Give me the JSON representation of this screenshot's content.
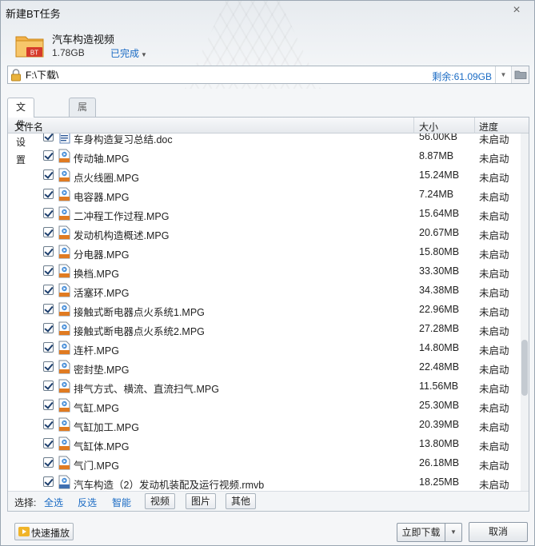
{
  "window": {
    "title": "新建BT任务",
    "close_icon": "×"
  },
  "task": {
    "name": "汽车构造视频",
    "size": "1.78GB",
    "status": "已完成",
    "badge": "BT",
    "accent": "#f0a436"
  },
  "path": {
    "value": "F:\\下载\\",
    "free_space": "剩余:61.09GB"
  },
  "tabs": [
    {
      "label": "文件设置",
      "active": true
    },
    {
      "label": "属性设置",
      "active": false
    }
  ],
  "columns": {
    "name": "文件名",
    "size": "大小",
    "progress": "进度"
  },
  "files": [
    {
      "name": "车身构造复习总结.doc",
      "size": "56.00KB",
      "progress": "未启动",
      "type": "doc"
    },
    {
      "name": "传动轴.MPG",
      "size": "8.87MB",
      "progress": "未启动",
      "type": "mpg"
    },
    {
      "name": "点火线圈.MPG",
      "size": "15.24MB",
      "progress": "未启动",
      "type": "mpg"
    },
    {
      "name": "电容器.MPG",
      "size": "7.24MB",
      "progress": "未启动",
      "type": "mpg"
    },
    {
      "name": "二冲程工作过程.MPG",
      "size": "15.64MB",
      "progress": "未启动",
      "type": "mpg"
    },
    {
      "name": "发动机构造概述.MPG",
      "size": "20.67MB",
      "progress": "未启动",
      "type": "mpg"
    },
    {
      "name": "分电器.MPG",
      "size": "15.80MB",
      "progress": "未启动",
      "type": "mpg"
    },
    {
      "name": "换档.MPG",
      "size": "33.30MB",
      "progress": "未启动",
      "type": "mpg"
    },
    {
      "name": "活塞环.MPG",
      "size": "34.38MB",
      "progress": "未启动",
      "type": "mpg"
    },
    {
      "name": "接触式断电器点火系统1.MPG",
      "size": "22.96MB",
      "progress": "未启动",
      "type": "mpg"
    },
    {
      "name": "接触式断电器点火系统2.MPG",
      "size": "27.28MB",
      "progress": "未启动",
      "type": "mpg"
    },
    {
      "name": "连杆.MPG",
      "size": "14.80MB",
      "progress": "未启动",
      "type": "mpg"
    },
    {
      "name": "密封垫.MPG",
      "size": "22.48MB",
      "progress": "未启动",
      "type": "mpg"
    },
    {
      "name": "排气方式、横流、直流扫气.MPG",
      "size": "11.56MB",
      "progress": "未启动",
      "type": "mpg"
    },
    {
      "name": "气缸.MPG",
      "size": "25.30MB",
      "progress": "未启动",
      "type": "mpg"
    },
    {
      "name": "气缸加工.MPG",
      "size": "20.39MB",
      "progress": "未启动",
      "type": "mpg"
    },
    {
      "name": "气缸体.MPG",
      "size": "13.80MB",
      "progress": "未启动",
      "type": "mpg"
    },
    {
      "name": "气门.MPG",
      "size": "26.18MB",
      "progress": "未启动",
      "type": "mpg"
    },
    {
      "name": "汽车构造（2）发动机装配及运行视频.rmvb",
      "size": "18.25MB",
      "progress": "未启动",
      "type": "rmvb"
    }
  ],
  "select_bar": {
    "label": "选择:",
    "all": "全选",
    "invert": "反选",
    "smart": "智能",
    "video": "视频",
    "image": "图片",
    "other": "其他"
  },
  "footer": {
    "quick_play": "快速播放",
    "download": "立即下载",
    "cancel": "取消"
  },
  "colors": {
    "link": "#1a6bc4",
    "accent": "#f0a436"
  }
}
